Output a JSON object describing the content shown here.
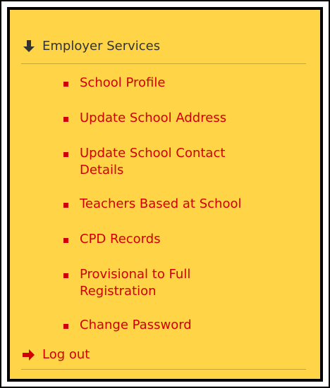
{
  "nav": {
    "section_title": "Employer Services",
    "items": [
      {
        "label": "School Profile"
      },
      {
        "label": "Update School Address"
      },
      {
        "label": "Update School Contact\nDetails"
      },
      {
        "label": "Teachers Based at School"
      },
      {
        "label": "CPD Records"
      },
      {
        "label": "Provisional to Full\nRegistration"
      },
      {
        "label": "Change Password"
      }
    ],
    "logout_label": "Log out"
  },
  "colors": {
    "panel_background": "#ffd447",
    "link": "#d10000",
    "header_text": "#333333",
    "divider": "#c7a533",
    "border": "#000000"
  },
  "icons": {
    "section_toggle": "arrow-down-icon",
    "logout": "arrow-right-icon",
    "item_marker": "square-bullet-icon"
  }
}
